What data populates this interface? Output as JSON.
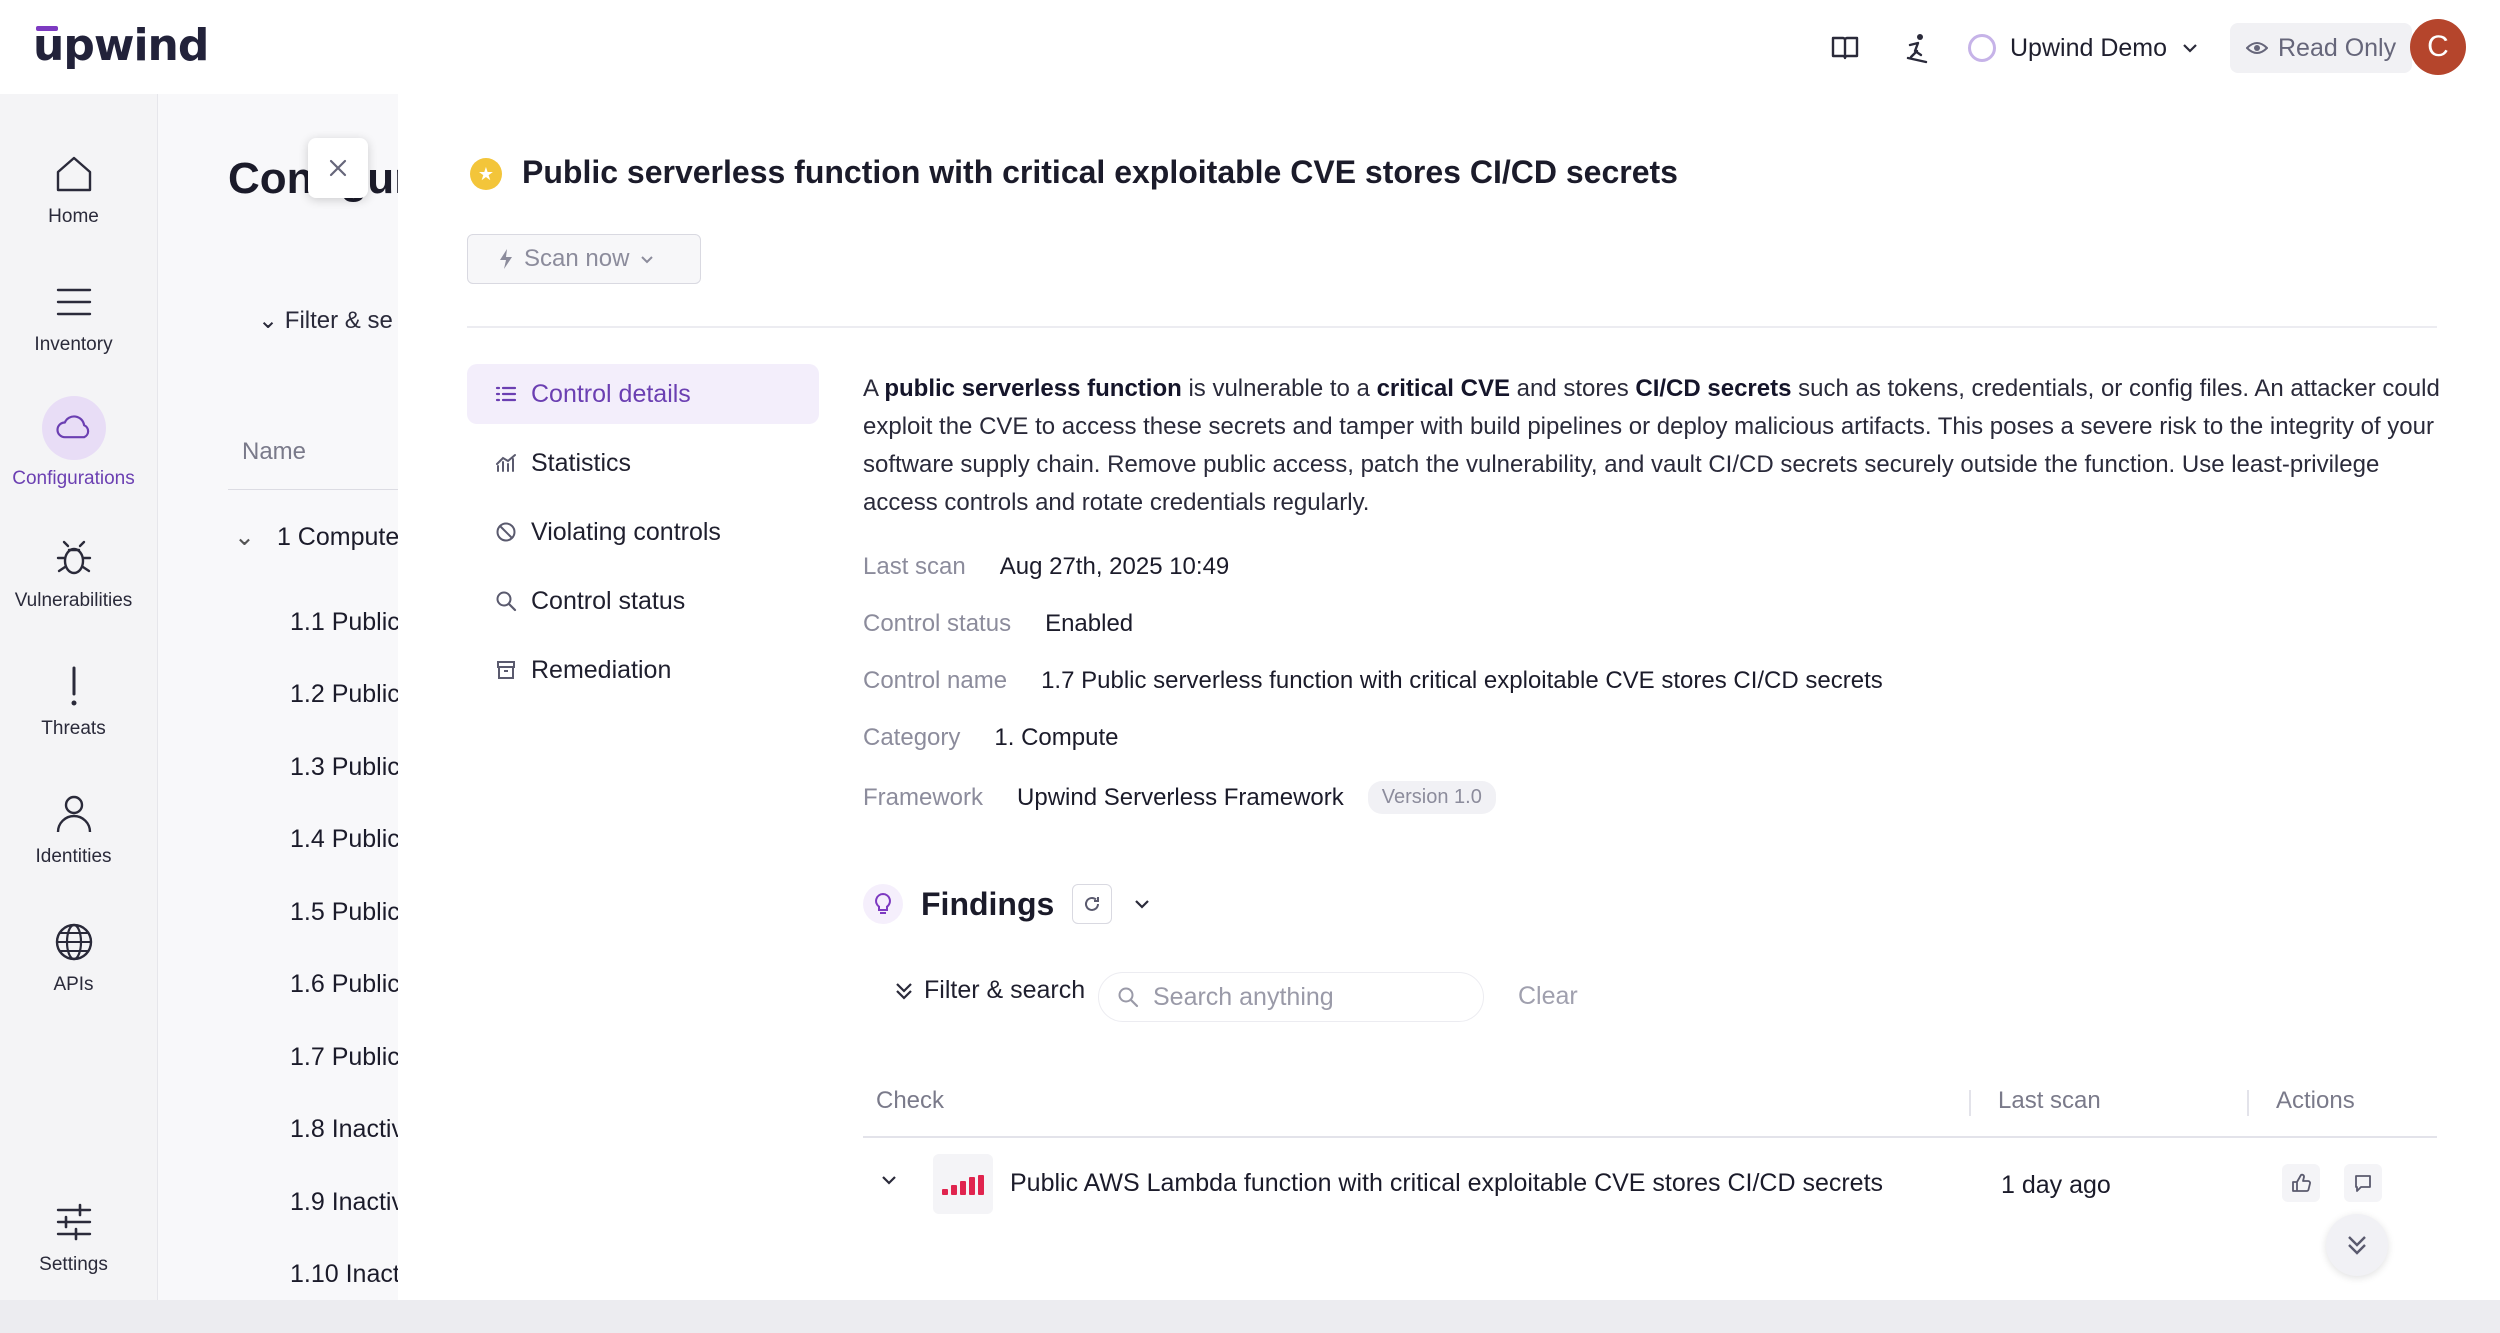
{
  "header": {
    "logo": "upwind",
    "workspace": "Upwind Demo",
    "read_only": "Read Only",
    "avatar_initial": "C",
    "icons": [
      "book-icon",
      "skier-icon",
      "workspace-ring-icon",
      "chevron-down-icon",
      "eye-icon"
    ]
  },
  "sidebar": {
    "items": [
      {
        "label": "Home",
        "icon": "home-icon"
      },
      {
        "label": "Inventory",
        "icon": "menu-lines-icon"
      },
      {
        "label": "Configurations",
        "icon": "cloud-icon",
        "active": true
      },
      {
        "label": "Vulnerabilities",
        "icon": "bug-icon"
      },
      {
        "label": "Threats",
        "icon": "exclamation-icon"
      },
      {
        "label": "Identities",
        "icon": "person-icon"
      },
      {
        "label": "APIs",
        "icon": "globe-icon"
      },
      {
        "label": "Settings",
        "icon": "sliders-icon"
      }
    ]
  },
  "background_page": {
    "title": "Configur",
    "filter": "Filter & se",
    "name_header": "Name",
    "group": "1 Compute",
    "rows": [
      "1.1 Public",
      "1.2 Public",
      "1.3 Public",
      "1.4 Public",
      "1.5 Public",
      "1.6 Public",
      "1.7 Public",
      "1.8 Inactiv",
      "1.9 Inactiv",
      "1.10 Inact"
    ]
  },
  "drawer": {
    "title": "Public serverless function with critical exploitable CVE stores CI/CD secrets",
    "scan_button": "Scan now",
    "menu": [
      {
        "label": "Control details",
        "icon": "list-icon",
        "active": true
      },
      {
        "label": "Statistics",
        "icon": "chart-icon"
      },
      {
        "label": "Violating controls",
        "icon": "prohibited-icon"
      },
      {
        "label": "Control status",
        "icon": "search-icon"
      },
      {
        "label": "Remediation",
        "icon": "archive-icon"
      }
    ],
    "description": {
      "p1": "A ",
      "b1": "public serverless function",
      "p2": " is vulnerable to a ",
      "b2": "critical CVE",
      "p3": " and stores ",
      "b3": "CI/CD secrets",
      "p4": " such as tokens, credentials, or config files. An attacker could exploit the CVE to access these secrets and tamper with build pipelines or deploy malicious artifacts. This poses a severe risk to the integrity of your software supply chain. Remove public access, patch the vulnerability, and vault CI/CD secrets securely outside the function. Use least-privilege access controls and rotate credentials regularly."
    },
    "meta": {
      "last_scan_label": "Last scan",
      "last_scan_value": "Aug 27th, 2025 10:49",
      "status_label": "Control status",
      "status_value": "Enabled",
      "name_label": "Control name",
      "name_value": "1.7 Public serverless function with critical exploitable CVE stores CI/CD secrets",
      "category_label": "Category",
      "category_value": "1. Compute",
      "framework_label": "Framework",
      "framework_value": "Upwind Serverless Framework",
      "framework_version": "Version 1.0"
    },
    "findings": {
      "title": "Findings",
      "filter_label": "Filter & search",
      "search_placeholder": "Search anything",
      "clear_label": "Clear",
      "columns": {
        "check": "Check",
        "last_scan": "Last scan",
        "actions": "Actions"
      },
      "rows": [
        {
          "check": "Public AWS Lambda function with critical exploitable CVE stores CI/CD secrets",
          "last_scan": "1 day ago",
          "severity": "critical"
        }
      ]
    }
  },
  "colors": {
    "accent": "#6b3fb2",
    "severity_critical": "#e0244e",
    "avatar": "#b5452c",
    "title_badge": "#f3c53a"
  }
}
